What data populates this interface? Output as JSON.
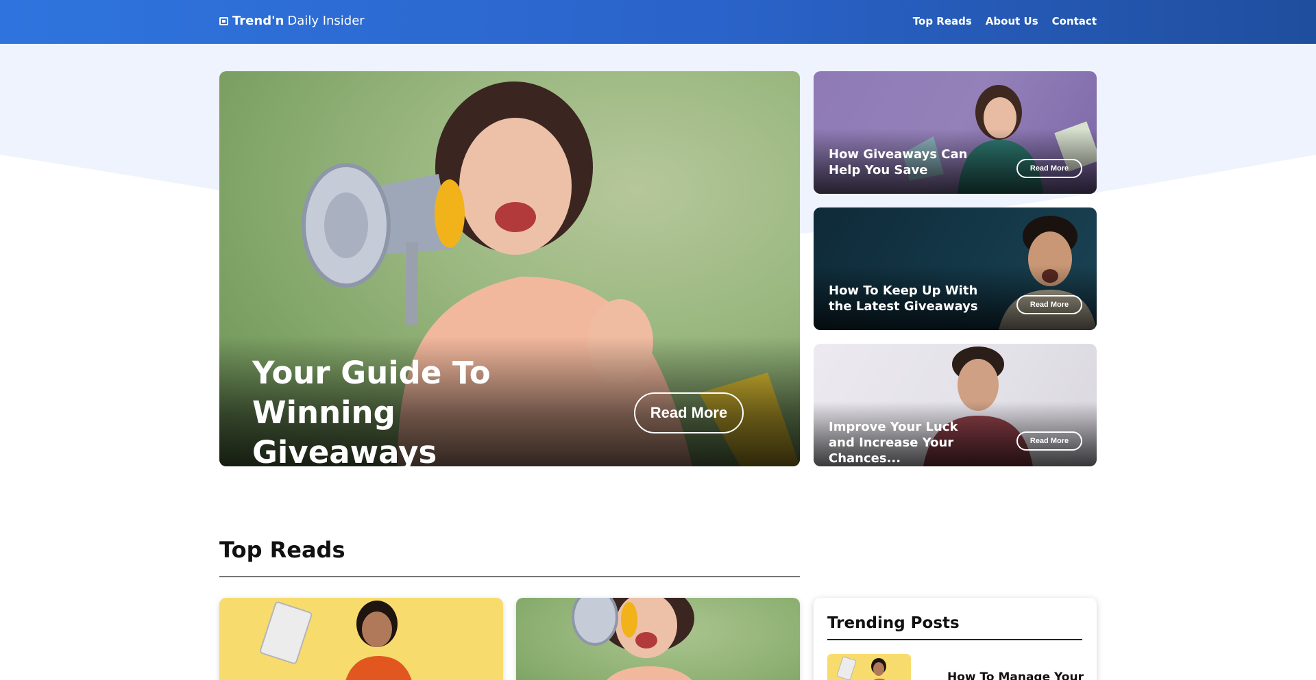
{
  "header": {
    "logo_brand": "Trend'n",
    "logo_rest": "Daily Insider",
    "nav": [
      "Top Reads",
      "About Us",
      "Contact"
    ]
  },
  "hero": {
    "title": "Your Guide To Winning Giveaways",
    "button": "Read More"
  },
  "cards": [
    {
      "title": "How Giveaways Can Help You Save",
      "button": "Read More"
    },
    {
      "title": "How To Keep Up With the Latest Giveaways",
      "button": "Read More"
    },
    {
      "title": "Improve Your Luck and Increase Your Chances...",
      "button": "Read More"
    }
  ],
  "top_reads": {
    "title": "Top Reads"
  },
  "trending": {
    "title": "Trending Posts",
    "first_post": "How To Manage Your"
  }
}
